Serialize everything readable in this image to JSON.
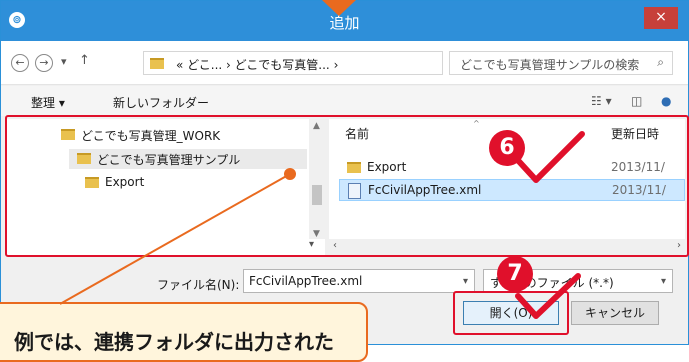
{
  "dialog": {
    "title": "追加",
    "close_glyph": "×",
    "title_icon": "⊚"
  },
  "address": {
    "back_glyph": "←",
    "forward_glyph": "→",
    "recent_glyph": "▾",
    "up_glyph": "↑",
    "path": "« どこ... › どこでも写真管... ›",
    "refresh_glyph": "↻",
    "search_placeholder": "どこでも写真管理サンプルの検索",
    "search_glyph": "⌕"
  },
  "toolbar": {
    "organize": "整理 ▾",
    "new_folder": "新しいフォルダー"
  },
  "tree": {
    "items": [
      {
        "label": "どこでも写真管理_WORK"
      },
      {
        "label": "どこでも写真管理サンプル"
      },
      {
        "label": "Export"
      }
    ]
  },
  "files": {
    "columns": [
      "名前",
      "更新日時"
    ],
    "rows": [
      {
        "name": "Export",
        "date": "2013/11/"
      },
      {
        "name": "FcCivilAppTree.xml",
        "date": "2013/11/"
      }
    ]
  },
  "footer": {
    "filename_label": "ファイル名(N):",
    "filename_value": "FcCivilAppTree.xml",
    "filetype_value": "すべてのファイル (*.*)",
    "open_label": "開く(O)",
    "cancel_label": "キャンセル"
  },
  "annotations": {
    "marker_6": "6",
    "marker_7": "7",
    "callout_text": "例では、連携フォルダに出力された"
  },
  "colors": {
    "title_bar": "#2e8fd9",
    "highlight_red": "#e0102b",
    "callout_orange": "#e96a1f",
    "selection": "#cde8ff"
  }
}
